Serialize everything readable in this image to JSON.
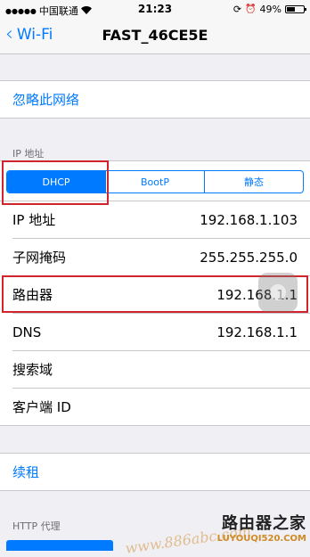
{
  "status_bar": {
    "carrier": "中国联通",
    "time": "21:23",
    "battery_percent": "49%",
    "battery_level": 0.49
  },
  "nav": {
    "back_label": "Wi-Fi",
    "title": "FAST_46CE5E"
  },
  "forget_network": "忽略此网络",
  "ip_section": {
    "header": "IP 地址",
    "segments": [
      "DHCP",
      "BootP",
      "静态"
    ],
    "selected_segment": "DHCP"
  },
  "rows": [
    {
      "label": "IP 地址",
      "value": "192.168.1.103"
    },
    {
      "label": "子网掩码",
      "value": "255.255.255.0"
    },
    {
      "label": "路由器",
      "value": "192.168.1.1"
    },
    {
      "label": "DNS",
      "value": "192.168.1.1"
    },
    {
      "label": "搜索域",
      "value": ""
    },
    {
      "label": "客户端 ID",
      "value": ""
    }
  ],
  "renew_lease": "续租",
  "http_proxy_header": "HTTP 代理",
  "watermark": {
    "title": "路由器之家",
    "url": "LUYOUQI520.COM",
    "overlay": "www.886abc.com"
  },
  "colors": {
    "accent": "#007aff",
    "highlight": "#d0252c",
    "background": "#efeff4"
  }
}
